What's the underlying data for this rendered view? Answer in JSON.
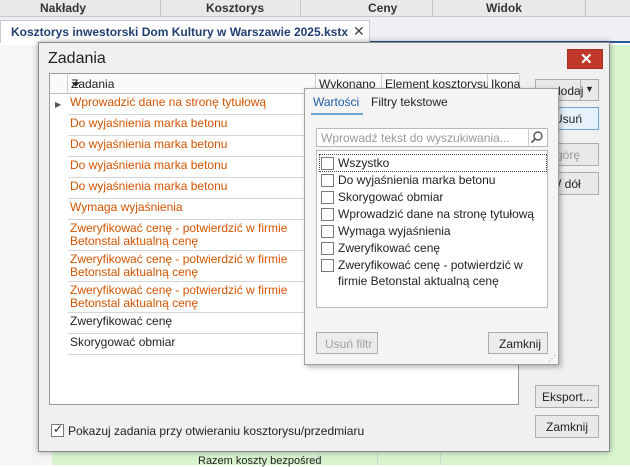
{
  "ribbon": {
    "items": [
      "Nakłady",
      "Kosztorys",
      "Ceny",
      "Widok"
    ]
  },
  "document_tab": {
    "title": "Kosztorys inwestorski Dom Kultury w Warszawie 2025.kstx",
    "close_glyph": "✕"
  },
  "background": {
    "bottom_text": "Razem koszty bezpośred"
  },
  "dialog": {
    "title": "Zadania",
    "close_glyph": "✕",
    "columns": [
      "Zadania",
      "Wykonano",
      "Element kosztorysu",
      "Ikona"
    ],
    "rows": [
      {
        "text": "Wprowadzić dane na stronę tytułową",
        "color": "orange"
      },
      {
        "text": "Do wyjaśnienia marka betonu",
        "color": "orange"
      },
      {
        "text": "Do wyjaśnienia marka betonu",
        "color": "orange"
      },
      {
        "text": "Do wyjaśnienia marka betonu",
        "color": "orange"
      },
      {
        "text": "Do wyjaśnienia marka betonu",
        "color": "orange"
      },
      {
        "text": "Wymaga wyjaśnienia",
        "color": "orange"
      },
      {
        "text": "Zweryfikować cenę - potwierdzić w firmie Betonstal aktualną cenę",
        "color": "orange"
      },
      {
        "text": "Zweryfikować cenę - potwierdzić w firmie Betonstal aktualną cenę",
        "color": "orange"
      },
      {
        "text": "Zweryfikować cenę - potwierdzić w firmie Betonstal aktualną cenę",
        "color": "orange"
      },
      {
        "text": "Zweryfikować cenę",
        "color": "black"
      },
      {
        "text": "Skorygować obmiar",
        "color": "black"
      }
    ],
    "buttons": {
      "add": "dodaj",
      "delete": "Usuń",
      "up": "górę",
      "down": "W dół",
      "export": "Eksport...",
      "close": "Zamknij"
    },
    "show_on_open_label": "Pokazuj zadania przy otwieraniu kosztorysu/przedmiaru",
    "show_on_open_checked": true
  },
  "filter_popup": {
    "tabs": [
      "Wartości",
      "Filtry tekstowe"
    ],
    "search_placeholder": "Wprowadź tekst do wyszukiwania...",
    "items": [
      "Wszystko",
      "Do wyjaśnienia marka betonu",
      "Skorygować obmiar",
      "Wprowadzić dane na stronę tytułową",
      "Wymaga wyjaśnienia",
      "Zweryfikować cenę",
      "Zweryfikować cenę - potwierdzić w firmie Betonstal aktualną cenę"
    ],
    "clear_filter_label": "Usuń filtr",
    "close_label": "Zamknij"
  },
  "colors": {
    "orange_text": "#d35400",
    "close_red": "#c0392b",
    "accent_blue": "#1f5fa8",
    "grid_green": "#d8f5cf"
  }
}
